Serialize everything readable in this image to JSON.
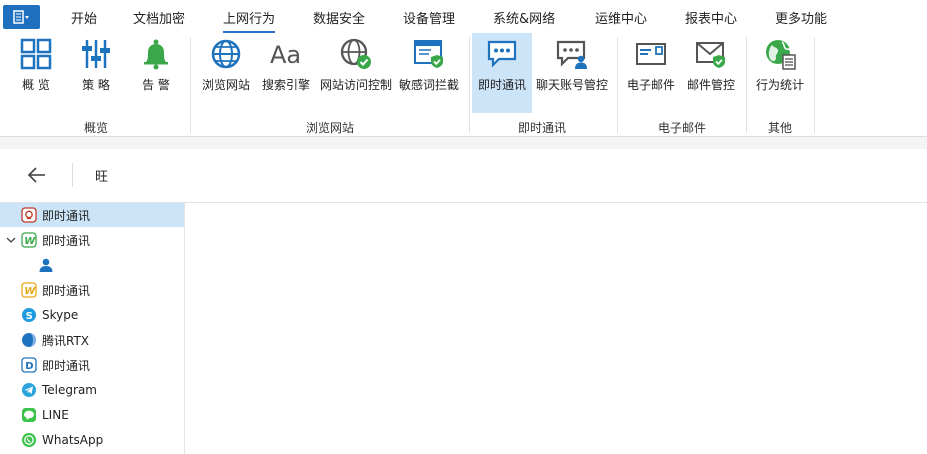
{
  "menubar": {
    "app_menu_icon": "app-menu-icon",
    "tabs": [
      {
        "label": "开始"
      },
      {
        "label": "文档加密"
      },
      {
        "label": "上网行为"
      },
      {
        "label": "数据安全"
      },
      {
        "label": "设备管理"
      },
      {
        "label": "系统&网络"
      },
      {
        "label": "运维中心"
      },
      {
        "label": "报表中心"
      },
      {
        "label": "更多功能"
      }
    ],
    "active_tab": "上网行为"
  },
  "ribbon": {
    "buttons": [
      {
        "label": "概 览",
        "icon": "overview-grid-icon"
      },
      {
        "label": "策 略",
        "icon": "policy-sliders-icon"
      },
      {
        "label": "告 警",
        "icon": "alert-bell-icon"
      },
      {
        "label": "浏览网站",
        "icon": "globe-icon"
      },
      {
        "label": "搜索引擎",
        "icon": "search-engine-aa-icon"
      },
      {
        "label": "网站访问控制",
        "icon": "globe-check-icon"
      },
      {
        "label": "敏感词拦截",
        "icon": "window-shield-icon"
      },
      {
        "label": "即时通讯",
        "icon": "chat-bubble-icon"
      },
      {
        "label": "聊天账号管控",
        "icon": "chat-user-icon"
      },
      {
        "label": "电子邮件",
        "icon": "email-icon"
      },
      {
        "label": "邮件管控",
        "icon": "email-shield-icon"
      },
      {
        "label": "行为统计",
        "icon": "globe-stats-icon"
      }
    ],
    "groups": [
      {
        "label": "概览"
      },
      {
        "label": "浏览网站"
      },
      {
        "label": "即时通讯"
      },
      {
        "label": "电子邮件"
      },
      {
        "label": "其他"
      }
    ],
    "selected_button": "即时通讯",
    "accent_color": "#2b73c9",
    "selected_bg": "#cce4f7"
  },
  "nav": {
    "back_icon": "back-arrow-icon",
    "title": "旺"
  },
  "tree": {
    "items": [
      {
        "label": "即时通讯",
        "icon": "qq-icon"
      },
      {
        "label": "即时通讯",
        "icon": "wechat-w-icon"
      },
      {
        "label": "",
        "icon": "user-icon"
      },
      {
        "label": "即时通讯",
        "icon": "wangwang-w-icon"
      },
      {
        "label": "Skype",
        "icon": "skype-icon"
      },
      {
        "label": "腾讯RTX",
        "icon": "rtx-icon"
      },
      {
        "label": "即时通讯",
        "icon": "dingtalk-d-icon"
      },
      {
        "label": "Telegram",
        "icon": "telegram-icon"
      },
      {
        "label": "LINE",
        "icon": "line-icon"
      },
      {
        "label": "WhatsApp",
        "icon": "whatsapp-icon"
      }
    ]
  }
}
